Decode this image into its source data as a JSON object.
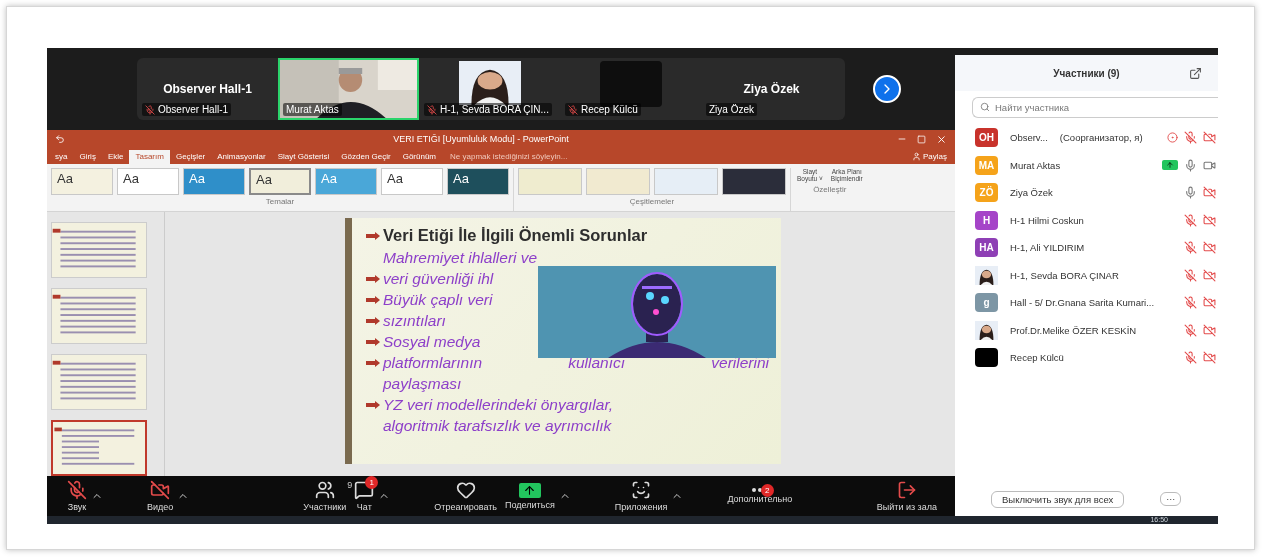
{
  "video_strip": {
    "tiles": [
      {
        "kind": "name",
        "name": "Observer Hall-1",
        "label": "Observer Hall-1",
        "muted": true,
        "speaking": false
      },
      {
        "kind": "video",
        "label": "Murat Aktas",
        "muted": false,
        "speaking": true
      },
      {
        "label": "H-1, Sevda BORA ÇIN...",
        "muted": true,
        "speaking": false
      },
      {
        "kind": "dark",
        "label": "Recep Külcü",
        "muted": true,
        "speaking": false
      },
      {
        "kind": "name",
        "name": "Ziya Özek",
        "label": "Ziya Özek",
        "muted": false,
        "speaking": false
      }
    ]
  },
  "powerpoint": {
    "title": "VERI ETIĞI [Uyumluluk Modu] - PowerPoint",
    "tabs": [
      {
        "label": "sya",
        "selected": false
      },
      {
        "label": "Giriş",
        "selected": false
      },
      {
        "label": "Ekle",
        "selected": false
      },
      {
        "label": "Tasarım",
        "selected": true
      },
      {
        "label": "Geçişler",
        "selected": false
      },
      {
        "label": "Animasyonlar",
        "selected": false
      },
      {
        "label": "Slayt Gösterisi",
        "selected": false
      },
      {
        "label": "Gözden Geçir",
        "selected": false
      },
      {
        "label": "Görünüm",
        "selected": false
      }
    ],
    "tell_me": "Ne yapmak istediğinizi söyleyin...",
    "share": "Paylaş",
    "themes": [
      {
        "label": "Aa",
        "color": "#f4f1e0",
        "selected": false
      },
      {
        "label": "Aa",
        "color": "#ffffff",
        "selected": false
      },
      {
        "label": "Aa",
        "color": "#2f8fc9",
        "selected": false
      },
      {
        "label": "Aa",
        "color": "#f1eedb",
        "selected": true
      },
      {
        "label": "Aa",
        "color": "#4aa7d8",
        "selected": false
      },
      {
        "label": "Aa",
        "color": "#ffffff",
        "selected": false
      },
      {
        "label": "Aa",
        "color": "#1e4f5c",
        "selected": false
      }
    ],
    "themes_label": "Temalar",
    "variants": [
      {
        "color": "#efeccf"
      },
      {
        "color": "#f1ead0"
      },
      {
        "color": "#e6eef6"
      },
      {
        "color": "#2b2d3a"
      }
    ],
    "variants_label": "Çeşitlemeler",
    "customize": [
      {
        "line1": "Slayt",
        "line2": "Boyutu ˅"
      },
      {
        "line1": "Arka Planı",
        "line2": "Biçimlendir"
      }
    ],
    "customize_label": "Özelleştir",
    "thumbnails": [
      {
        "selected": false
      },
      {
        "selected": false
      },
      {
        "selected": false
      },
      {
        "selected": true
      }
    ],
    "slide": {
      "title": "Veri Etiği İle İlgili Önemli Sorunlar",
      "lines": [
        {
          "text": "Mahremiyet ihlalleri ve",
          "bullet": false
        },
        {
          "text": "veri güvenliği ihl",
          "bullet": true
        },
        {
          "text": "Büyük çaplı veri",
          "bullet": true
        },
        {
          "text": "sızıntıları",
          "bullet": true
        },
        {
          "text": "Sosyal medya",
          "bullet": true
        },
        {
          "text": "platformlarının kullanıcı verilerini",
          "bullet": true
        },
        {
          "text": "paylaşması",
          "bullet": false
        },
        {
          "text": "YZ veri modellerindeki önyargılar,",
          "bullet": true
        },
        {
          "text": "algoritmik tarafsızlık ve ayrımcılık",
          "bullet": false
        }
      ]
    }
  },
  "toolbar": [
    {
      "kind": "mic",
      "label": "Звук",
      "off": true,
      "caret": true
    },
    {
      "kind": "video",
      "label": "Видео",
      "off": true,
      "caret": true
    },
    {
      "kind": "participants",
      "label": "Участники",
      "count": "9",
      "caret": false
    },
    {
      "kind": "chat",
      "label": "Чат",
      "badge": "1",
      "caret": true
    },
    {
      "kind": "react",
      "label": "Отреагировать",
      "caret": false
    },
    {
      "kind": "share",
      "label": "Поделиться",
      "caret": true
    },
    {
      "kind": "apps",
      "label": "Приложения",
      "caret": true
    },
    {
      "kind": "more",
      "label": "Дополнительно",
      "badge": "2",
      "caret": false
    },
    {
      "kind": "leave",
      "label": "Выйти из зала",
      "caret": false
    }
  ],
  "panel": {
    "title": "Участники (9)",
    "search": {
      "placeholder": "Найти участника"
    },
    "participants": [
      {
        "kind": "initials",
        "initials": "OH",
        "color": "#c8322b",
        "name": "Observ...",
        "role": "(Соорганизатор, я)",
        "recording": true,
        "sharing": false,
        "muted": true,
        "video": false
      },
      {
        "kind": "initials",
        "initials": "MA",
        "color": "#f5a31a",
        "name": "Murat Aktas",
        "recording": false,
        "sharing": true,
        "muted": false,
        "video": true
      },
      {
        "kind": "initials",
        "initials": "ZÖ",
        "color": "#f5a31a",
        "name": "Ziya Özek",
        "recording": false,
        "sharing": false,
        "muted": false,
        "video": false
      },
      {
        "kind": "initials",
        "initials": "H",
        "color": "#a544c8",
        "name": "H-1 Hilmi Coskun",
        "recording": false,
        "sharing": false,
        "muted": true,
        "video": false
      },
      {
        "kind": "initials",
        "initials": "HA",
        "color": "#8e3fb5",
        "name": "H-1, Ali YILDIRIM",
        "recording": false,
        "sharing": false,
        "muted": true,
        "video": false
      },
      {
        "name": "H-1, Sevda BORA ÇINAR",
        "recording": false,
        "sharing": false,
        "muted": true,
        "video": false
      },
      {
        "kind": "initials",
        "initials": "g",
        "color": "#7d96a5",
        "name": "Hall - 5/ Dr.Gnana Sarita Kumari...",
        "recording": false,
        "sharing": false,
        "muted": true,
        "video": false
      },
      {
        "name": "Prof.Dr.Melike ÖZER KESKİN",
        "recording": false,
        "sharing": false,
        "muted": true,
        "video": false
      },
      {
        "kind": "blank",
        "color": "#000000",
        "name": "Recep Külcü",
        "recording": false,
        "sharing": false,
        "muted": true,
        "video": false
      }
    ],
    "mute_all": "Выключить звук для всех",
    "more": "···"
  },
  "taskbar": {
    "time": "16:50"
  }
}
